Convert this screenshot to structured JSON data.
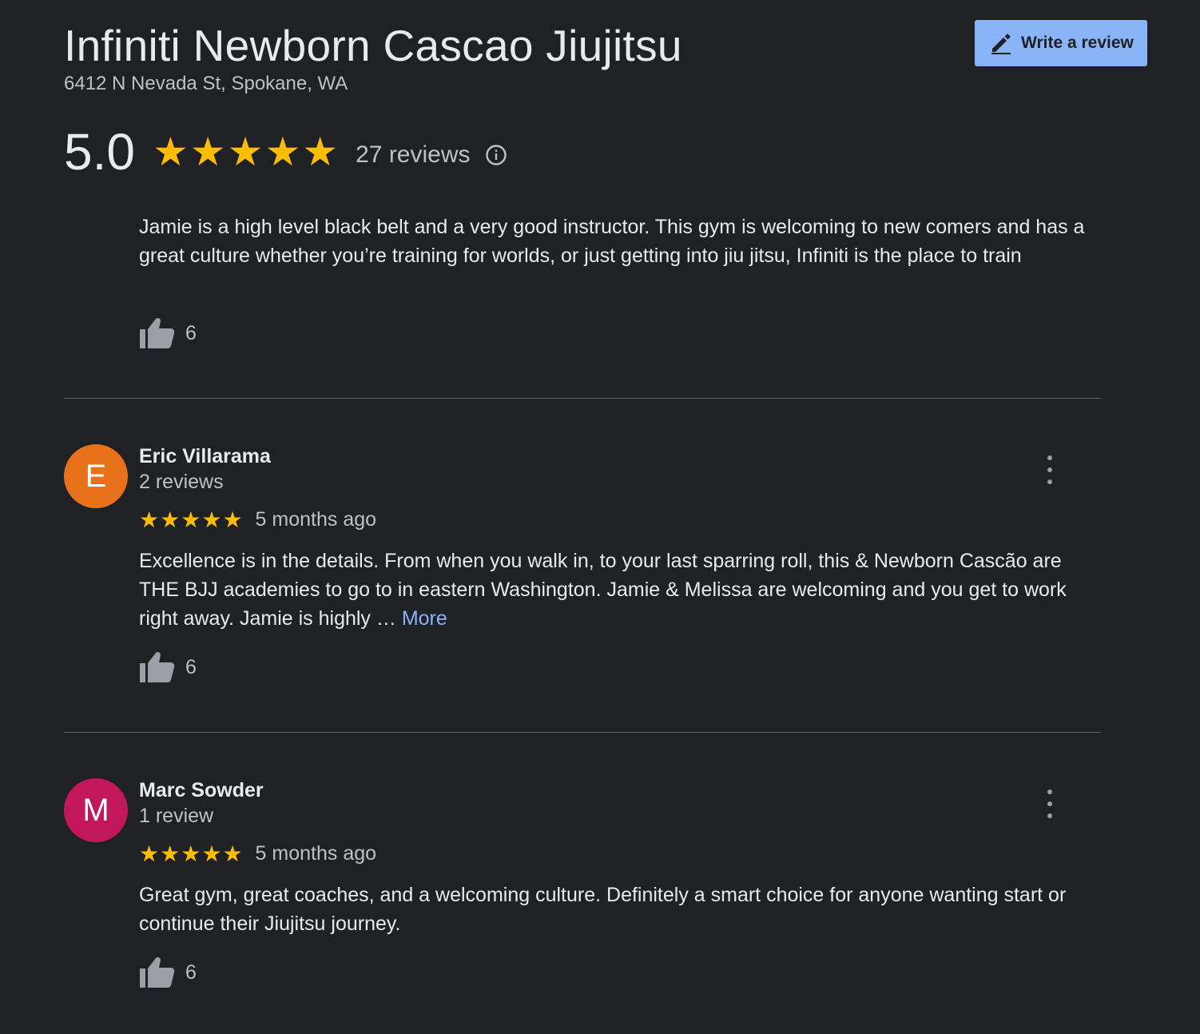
{
  "place": {
    "name": "Infiniti Newborn Cascao Jiujitsu",
    "address": "6412 N Nevada St, Spokane, WA"
  },
  "write_review": {
    "label": "Write a review",
    "icon": "pencil-icon",
    "color": "#8ab4f8"
  },
  "summary": {
    "score": "5.0",
    "stars": 5,
    "review_count": "27 reviews",
    "info_icon": "info-icon"
  },
  "colors": {
    "background": "#202124",
    "star": "#fbbc04",
    "link": "#8ab4f8"
  },
  "reviews": [
    {
      "text": "Jamie is a high level black belt and a very good instructor. This gym is welcoming to new comers and has a great culture whether you’re training for worlds, or just getting into jiu jitsu, Infiniti is the place to train",
      "likes": "6"
    },
    {
      "author": "Eric Villarama",
      "initial": "E",
      "avatar_color": "#e8711c",
      "author_reviews": "2 reviews",
      "stars": 5,
      "date": "5 months ago",
      "text": "Excellence is in the details. From when you walk in, to your last sparring roll, this & Newborn Cascão are THE BJJ academies to go to in eastern Washington. Jamie & Melissa are welcoming and you get to work right away. Jamie is highly … ",
      "more_label": "More",
      "likes": "6"
    },
    {
      "author": "Marc Sowder",
      "initial": "M",
      "avatar_color": "#c2185b",
      "author_reviews": "1 review",
      "stars": 5,
      "date": "5 months ago",
      "text": "Great gym, great coaches, and a welcoming culture. Definitely a smart choice for anyone wanting start or continue their Jiujitsu journey.",
      "likes": "6"
    }
  ]
}
